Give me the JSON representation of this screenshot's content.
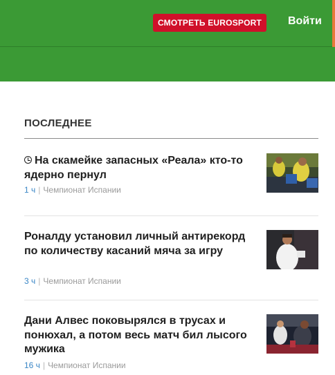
{
  "header": {
    "watch_button_label": "СМОТРЕТЬ EUROSPORT",
    "login_label": "Войти",
    "colors": {
      "background": "#3b9a35",
      "watch_button": "#d0102a"
    }
  },
  "section": {
    "title": "ПОСЛЕДНЕЕ"
  },
  "articles": [
    {
      "headline": "На скамейке запасных «Реала» кто-то ядерно пернул",
      "time": "1 ч",
      "separator": "|",
      "category": "Чемпионат Испании",
      "icon": "clock-icon",
      "thumbnail": "players-on-bench"
    },
    {
      "headline": "Роналду установил личный антирекорд по количеству касаний мяча за игру",
      "time": "3 ч",
      "separator": "|",
      "category": "Чемпионат Испании",
      "thumbnail": "player-in-white-kit"
    },
    {
      "headline": "Дани Алвес поковырялся в трусах и понюхал, а потом весь матч бил лысого мужика",
      "time": "16 ч",
      "separator": "|",
      "category": "Чемпионат Испании",
      "thumbnail": "players-on-bench-red"
    }
  ]
}
